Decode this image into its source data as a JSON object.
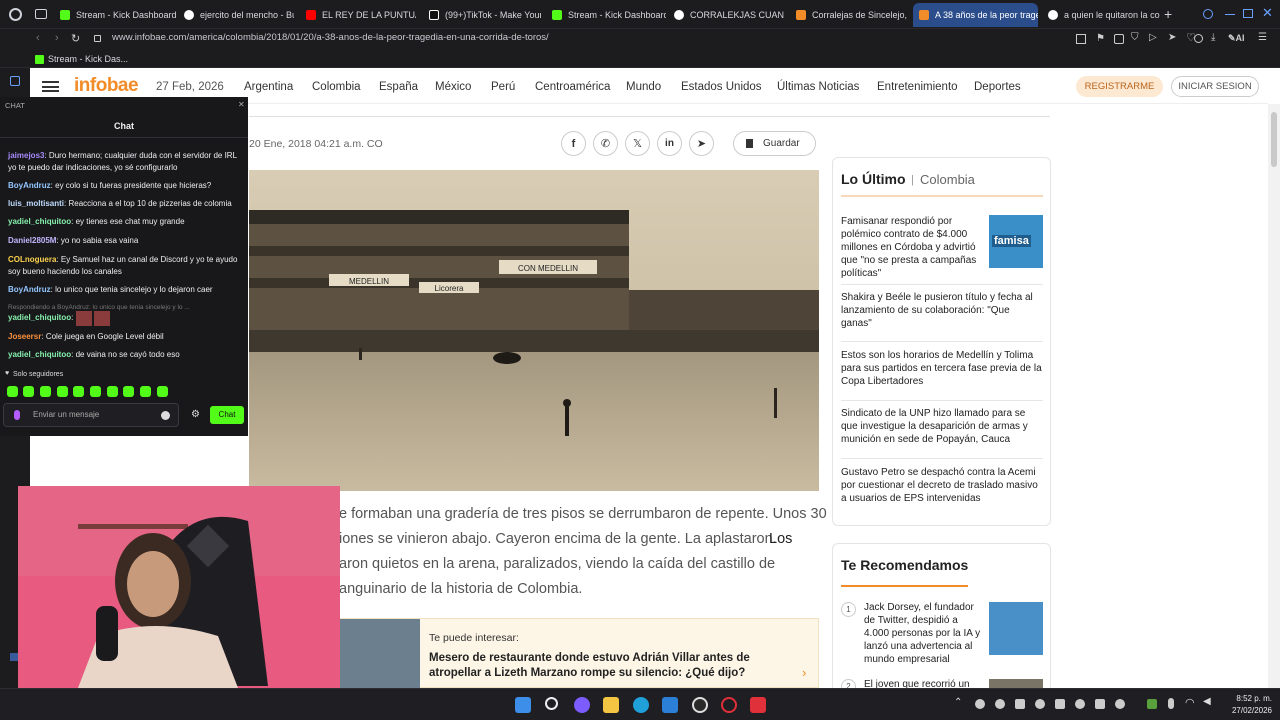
{
  "browser": {
    "tabs": [
      {
        "label": "Stream - Kick Dashboard",
        "color": "#53fc18"
      },
      {
        "label": "ejercito del mencho - Bu",
        "color": "#ffffff"
      },
      {
        "label": "EL REY DE LA PUNTUAL",
        "color": "#ff0000"
      },
      {
        "label": "(99+)TikTok - Make Your",
        "color": "#ffffff"
      },
      {
        "label": "Stream - Kick Dashboard",
        "color": "#53fc18"
      },
      {
        "label": "CORRALEKJAS CUANDO",
        "color": "#ffffff"
      },
      {
        "label": "Corralejas de Sincelejo,",
        "color": "#f28c28"
      },
      {
        "label": "A 38 años de la peor trage",
        "color": "#f28c28"
      },
      {
        "label": "a quien le quitaron la co",
        "color": "#ffffff"
      }
    ],
    "url": "www.infobae.com/america/colombia/2018/01/20/a-38-anos-de-la-peor-tragedia-en-una-corrida-de-toros/",
    "bookmark": "Stream - Kick Das..."
  },
  "site": {
    "logo": "infobae",
    "date": "27 Feb, 2026",
    "nav": [
      "Argentina",
      "Colombia",
      "España",
      "México",
      "Perú",
      "Centroamérica",
      "Mundo",
      "Estados Unidos",
      "Últimas Noticias",
      "Entretenimiento",
      "Deportes"
    ],
    "register": "REGISTRARME",
    "login": "INICIAR SESION"
  },
  "article": {
    "timestamp": "20 Ene, 2018 04:21 a.m. CO",
    "save": "Guardar",
    "body": [
      "e formaban una gradería de tres pisos se derrumbaron de repente. Unos 30",
      "iones se vinieron abajo. Cayeron encima de la gente. La aplastaron.",
      "aron quietos en la arena, paralizados, viendo la caída del castillo de",
      "anguinario de la historia de Colombia."
    ],
    "body_link": "Los",
    "promo_label": "Te puede interesar:",
    "promo_title_1": "Mesero de restaurante donde estuvo Adrián Villar antes de",
    "promo_title_2": "atropellar a Lizeth Marzano rompe su silencio: ¿Qué dijo?"
  },
  "photo": {
    "sign_1": "CON MEDELLIN",
    "sign_2": "MEDELLIN",
    "sign_3": "Licorera"
  },
  "latest": {
    "title": "Lo Último",
    "section": "Colombia",
    "items": [
      "Famisanar respondió por polémico contrato de $4.000 millones en Córdoba y advirtió que \"no se presta a campañas políticas\"",
      "Shakira y Beéle le pusieron título y fecha al lanzamiento de su colaboración: \"Que ganas\"",
      "Estos son los horarios de Medellín y Tolima para sus partidos en tercera fase previa de la Copa Libertadores",
      "Sindicato de la UNP hizo llamado para se que investigue la desaparición de armas y munición en sede de Popayán, Cauca",
      "Gustavo Petro se despachó contra la Acemi por cuestionar el decreto de traslado masivo a usuarios de EPS intervenidas"
    ],
    "thumb_text": "famisa"
  },
  "recommend": {
    "title": "Te Recomendamos",
    "items": [
      {
        "num": "1",
        "text": "Jack Dorsey, el fundador de Twitter, despidió a 4.000 personas por la IA y lanzó una advertencia al mundo empresarial"
      },
      {
        "num": "2",
        "text": "El joven que recorrió un"
      }
    ]
  },
  "chat": {
    "tab": "CHAT",
    "title": "Chat",
    "messages": [
      {
        "user": "jaimejos3",
        "color": "#a78bfa",
        "text": "Duro hermano; cualquier duda con el servidor de IRL yo te puedo dar indicaciones, yo sé configurarlo"
      },
      {
        "user": "BoyAndruz",
        "color": "#93c5fd",
        "text": "ey colo si tu fueras presidente que hicieras?"
      },
      {
        "user": "luis_moltisanti",
        "color": "#bfdbfe",
        "text": "Reacciona a el top 10 de pizzerias de colomia"
      },
      {
        "user": "yadiel_chiquitoo",
        "color": "#86efac",
        "text": "ey tienes ese chat muy grande"
      },
      {
        "user": "Daniel2805M",
        "color": "#c4b5fd",
        "text": "yo no sabia esa vaina"
      },
      {
        "user": "COLnoguera",
        "color": "#fcd34d",
        "text": "Ey Samuel haz un canal de Discord y yo te ayudo soy bueno haciendo los canales"
      },
      {
        "user": "BoyAndruz",
        "color": "#93c5fd",
        "text": "lo unico que tenia sincelejo y lo dejaron caer"
      },
      {
        "user": "yadiel_chiquitoo",
        "color": "#86efac",
        "text": ""
      },
      {
        "user": "Joseersr",
        "color": "#fb923c",
        "text": "Cole juega en Google Level débil"
      },
      {
        "user": "yadiel_chiquitoo",
        "color": "#86efac",
        "text": "de vaina no se cayó todo eso"
      }
    ],
    "reply_note": "Respondiendo a BoyAndruz: lo unico que tenia sincelejo y lo ...",
    "followers_only": "Solo seguidores",
    "placeholder": "Enviar un mensaje",
    "send": "Chat"
  },
  "taskbar": {
    "time": "8:52 p. m.",
    "date": "27/02/2026"
  }
}
